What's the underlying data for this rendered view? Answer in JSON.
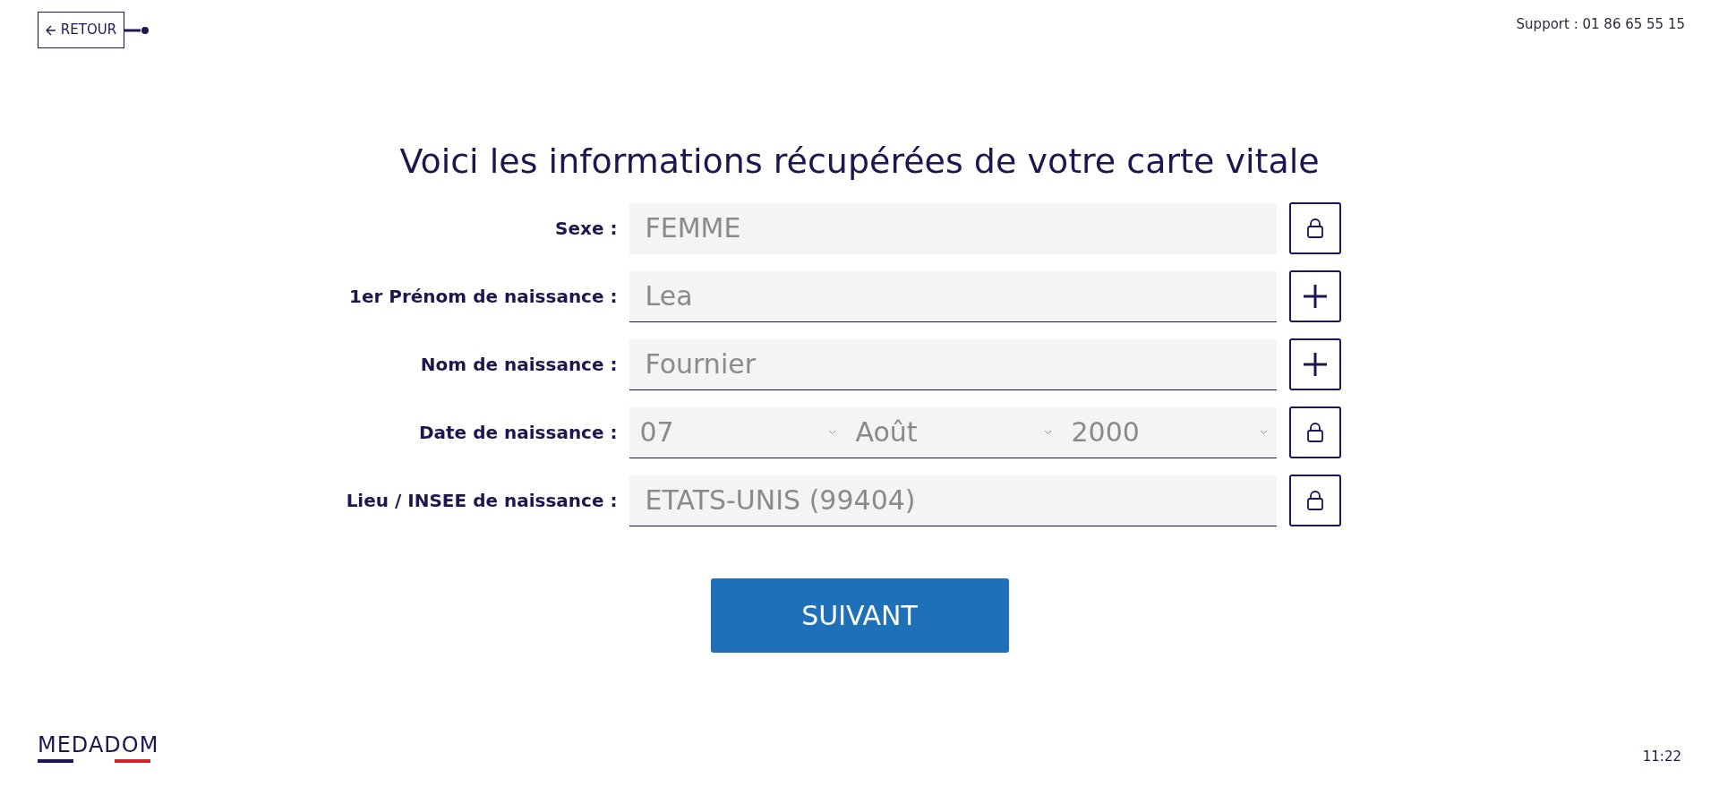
{
  "back_button": {
    "label": "RETOUR"
  },
  "support": "Support : 01 86 65 55 15",
  "title": "Voici les informations récupérées de votre carte vitale",
  "fields": [
    {
      "label": "Sexe :",
      "kind": "text",
      "value": "FEMME",
      "underline": false,
      "locked": true
    },
    {
      "label": "1er Prénom de naissance :",
      "kind": "text",
      "value": "Lea",
      "underline": true,
      "locked": false
    },
    {
      "label": "Nom de naissance :",
      "kind": "text",
      "value": "Fournier",
      "underline": true,
      "locked": false
    },
    {
      "label": "Date de naissance :",
      "kind": "date",
      "parts": [
        "07",
        "Août",
        "2000"
      ],
      "underline": true,
      "locked": true
    },
    {
      "label": "Lieu / INSEE de naissance :",
      "kind": "text",
      "value": "ETATS-UNIS (99404)",
      "underline": true,
      "locked": true
    }
  ],
  "next_button": "SUIVANT",
  "logo": "MEDADOM",
  "time": "11:22"
}
